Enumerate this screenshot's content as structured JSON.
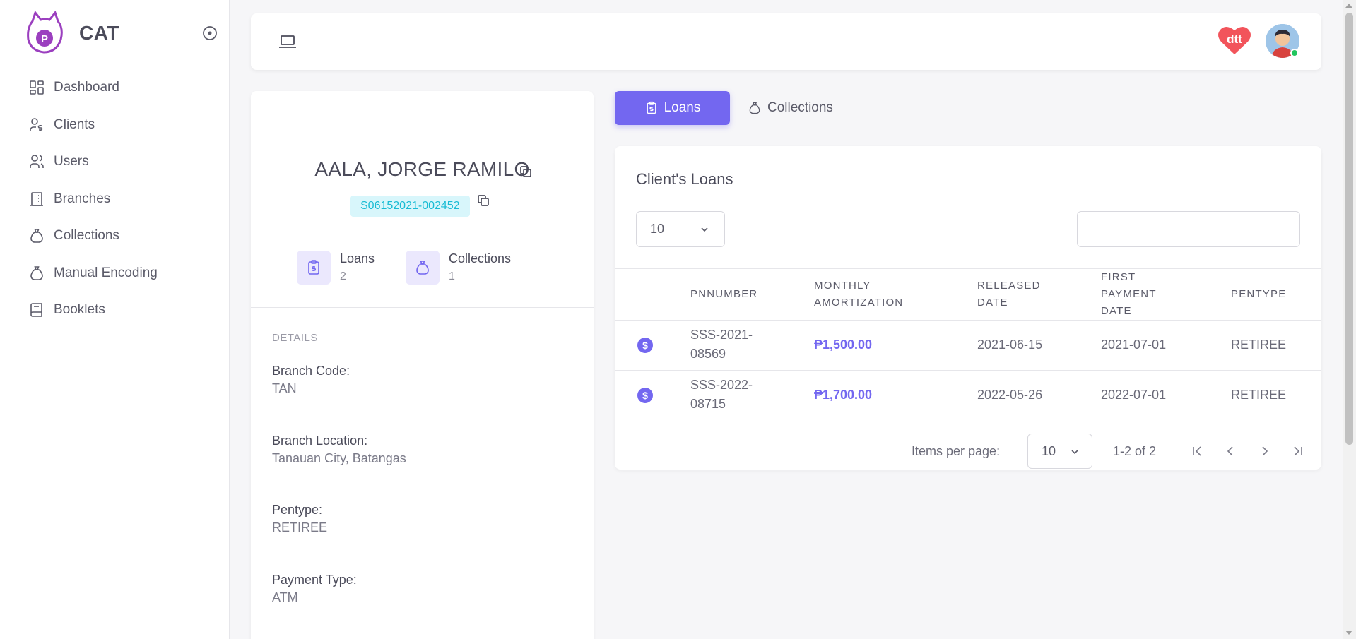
{
  "brand": {
    "name": "CAT",
    "logo_icon": "cat-logo-icon"
  },
  "sidebar": {
    "items": [
      {
        "label": "Dashboard",
        "icon": "dashboard-icon"
      },
      {
        "label": "Clients",
        "icon": "clients-icon"
      },
      {
        "label": "Users",
        "icon": "users-icon"
      },
      {
        "label": "Branches",
        "icon": "building-icon"
      },
      {
        "label": "Collections",
        "icon": "money-bag-icon"
      },
      {
        "label": "Manual Encoding",
        "icon": "money-bag-icon"
      },
      {
        "label": "Booklets",
        "icon": "book-icon"
      }
    ]
  },
  "topbar": {
    "logo_text": "dtt"
  },
  "client": {
    "name": "AALA, JORGE RAMILO",
    "code": "S06152021-002452",
    "stats": {
      "loans_label": "Loans",
      "loans_value": "2",
      "collections_label": "Collections",
      "collections_value": "1"
    },
    "details_title": "DETAILS",
    "details": [
      {
        "label": "Branch Code:",
        "value": "TAN"
      },
      {
        "label": "Branch Location:",
        "value": "Tanauan City, Batangas"
      },
      {
        "label": "Pentype:",
        "value": "RETIREE"
      },
      {
        "label": "Payment Type:",
        "value": "ATM"
      }
    ]
  },
  "tabs": {
    "loans": "Loans",
    "collections": "Collections"
  },
  "loans_table": {
    "title": "Client's Loans",
    "page_size": "10",
    "search_value": "",
    "columns": [
      "PNNUMBER",
      "MONTHLY AMORTIZATION",
      "RELEASED DATE",
      "FIRST PAYMENT DATE",
      "PENTYPE"
    ],
    "rows": [
      {
        "pnnumber": "SSS-2021-08569",
        "amortization": "₱1,500.00",
        "released": "2021-06-15",
        "first_payment": "2021-07-01",
        "pentype": "RETIREE"
      },
      {
        "pnnumber": "SSS-2022-08715",
        "amortization": "₱1,700.00",
        "released": "2022-05-26",
        "first_payment": "2022-07-01",
        "pentype": "RETIREE"
      }
    ],
    "pager": {
      "label": "Items per page:",
      "per_page": "10",
      "range": "1-2 of 2"
    }
  },
  "colors": {
    "accent": "#7367f0",
    "code_bg": "#d8f6fb",
    "code_text": "#18bcd4"
  }
}
